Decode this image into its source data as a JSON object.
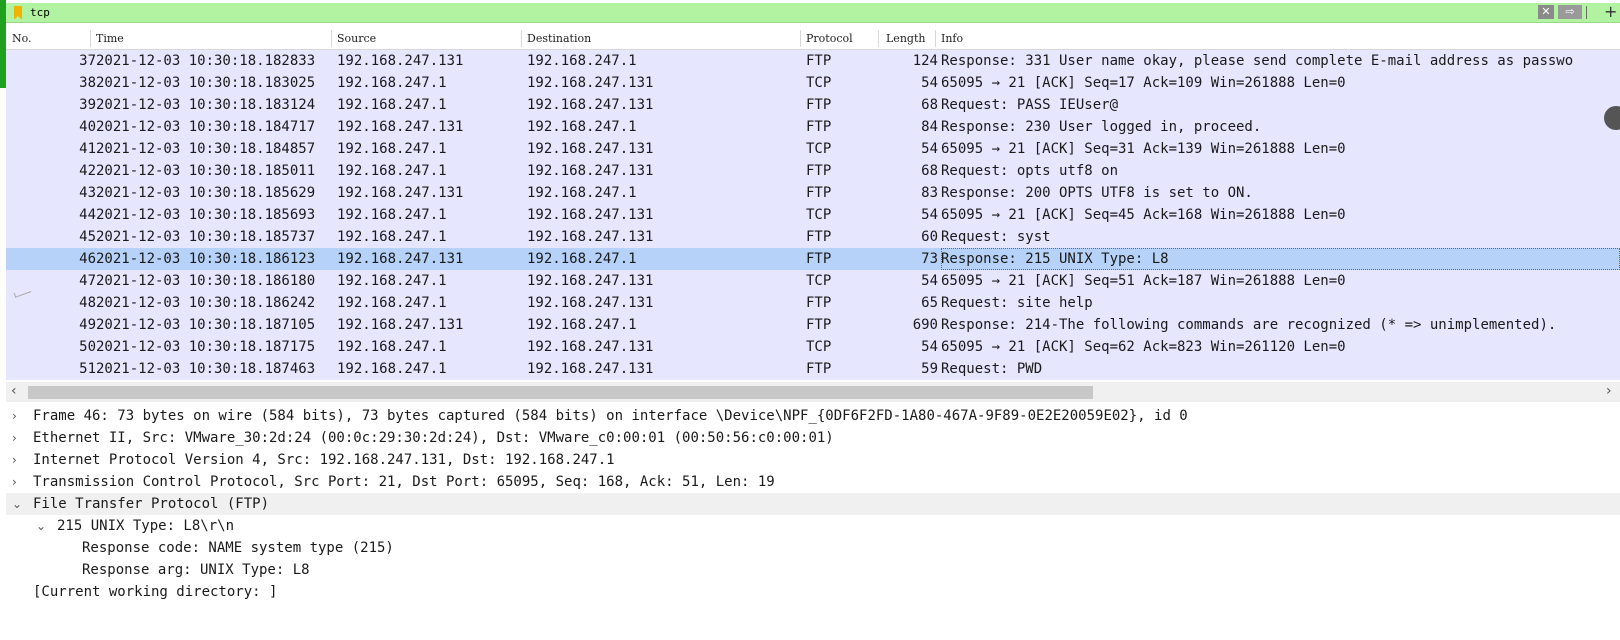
{
  "filter": {
    "value": "tcp"
  },
  "columns": [
    "No.",
    "Time",
    "Source",
    "Destination",
    "Protocol",
    "Length",
    "Info"
  ],
  "packets": [
    {
      "no": "37",
      "time": "2021-12-03 10:30:18.182833",
      "src": "192.168.247.131",
      "dst": "192.168.247.1",
      "proto": "FTP",
      "len": "124",
      "info": "Response: 331 User name okay, please send complete E-mail address as passwo"
    },
    {
      "no": "38",
      "time": "2021-12-03 10:30:18.183025",
      "src": "192.168.247.1",
      "dst": "192.168.247.131",
      "proto": "TCP",
      "len": "54",
      "info": "65095 → 21 [ACK] Seq=17 Ack=109 Win=261888 Len=0"
    },
    {
      "no": "39",
      "time": "2021-12-03 10:30:18.183124",
      "src": "192.168.247.1",
      "dst": "192.168.247.131",
      "proto": "FTP",
      "len": "68",
      "info": "Request: PASS IEUser@"
    },
    {
      "no": "40",
      "time": "2021-12-03 10:30:18.184717",
      "src": "192.168.247.131",
      "dst": "192.168.247.1",
      "proto": "FTP",
      "len": "84",
      "info": "Response: 230 User logged in, proceed."
    },
    {
      "no": "41",
      "time": "2021-12-03 10:30:18.184857",
      "src": "192.168.247.1",
      "dst": "192.168.247.131",
      "proto": "TCP",
      "len": "54",
      "info": "65095 → 21 [ACK] Seq=31 Ack=139 Win=261888 Len=0"
    },
    {
      "no": "42",
      "time": "2021-12-03 10:30:18.185011",
      "src": "192.168.247.1",
      "dst": "192.168.247.131",
      "proto": "FTP",
      "len": "68",
      "info": "Request: opts utf8 on"
    },
    {
      "no": "43",
      "time": "2021-12-03 10:30:18.185629",
      "src": "192.168.247.131",
      "dst": "192.168.247.1",
      "proto": "FTP",
      "len": "83",
      "info": "Response: 200 OPTS UTF8 is set to ON."
    },
    {
      "no": "44",
      "time": "2021-12-03 10:30:18.185693",
      "src": "192.168.247.1",
      "dst": "192.168.247.131",
      "proto": "TCP",
      "len": "54",
      "info": "65095 → 21 [ACK] Seq=45 Ack=168 Win=261888 Len=0"
    },
    {
      "no": "45",
      "time": "2021-12-03 10:30:18.185737",
      "src": "192.168.247.1",
      "dst": "192.168.247.131",
      "proto": "FTP",
      "len": "60",
      "info": "Request: syst"
    },
    {
      "no": "46",
      "time": "2021-12-03 10:30:18.186123",
      "src": "192.168.247.131",
      "dst": "192.168.247.1",
      "proto": "FTP",
      "len": "73",
      "info": "Response: 215 UNIX Type: L8",
      "selected": true
    },
    {
      "no": "47",
      "time": "2021-12-03 10:30:18.186180",
      "src": "192.168.247.1",
      "dst": "192.168.247.131",
      "proto": "TCP",
      "len": "54",
      "info": "65095 → 21 [ACK] Seq=51 Ack=187 Win=261888 Len=0"
    },
    {
      "no": "48",
      "time": "2021-12-03 10:30:18.186242",
      "src": "192.168.247.1",
      "dst": "192.168.247.131",
      "proto": "FTP",
      "len": "65",
      "info": "Request: site help"
    },
    {
      "no": "49",
      "time": "2021-12-03 10:30:18.187105",
      "src": "192.168.247.131",
      "dst": "192.168.247.1",
      "proto": "FTP",
      "len": "690",
      "info": "Response: 214-The following commands are recognized (* => unimplemented)."
    },
    {
      "no": "50",
      "time": "2021-12-03 10:30:18.187175",
      "src": "192.168.247.1",
      "dst": "192.168.247.131",
      "proto": "TCP",
      "len": "54",
      "info": "65095 → 21 [ACK] Seq=62 Ack=823 Win=261120 Len=0"
    },
    {
      "no": "51",
      "time": "2021-12-03 10:30:18.187463",
      "src": "192.168.247.1",
      "dst": "192.168.247.131",
      "proto": "FTP",
      "len": "59",
      "info": "Request: PWD"
    }
  ],
  "details": [
    {
      "twisty": "›",
      "text": "Frame 46: 73 bytes on wire (584 bits), 73 bytes captured (584 bits) on interface \\Device\\NPF_{0DF6F2FD-1A80-467A-9F89-0E2E20059E02}, id 0",
      "level": 0
    },
    {
      "twisty": "›",
      "text": "Ethernet II, Src: VMware_30:2d:24 (00:0c:29:30:2d:24), Dst: VMware_c0:00:01 (00:50:56:c0:00:01)",
      "level": 0
    },
    {
      "twisty": "›",
      "text": "Internet Protocol Version 4, Src: 192.168.247.131, Dst: 192.168.247.1",
      "level": 0
    },
    {
      "twisty": "›",
      "text": "Transmission Control Protocol, Src Port: 21, Dst Port: 65095, Seq: 168, Ack: 51, Len: 19",
      "level": 0
    },
    {
      "twisty": "⌄",
      "text": "File Transfer Protocol (FTP)",
      "level": 0,
      "stripe": true
    },
    {
      "twisty": "⌄",
      "text": "215 UNIX Type: L8\\r\\n",
      "level": 1
    },
    {
      "twisty": "",
      "text": "Response code: NAME system type (215)",
      "level": 2
    },
    {
      "twisty": "",
      "text": "Response arg: UNIX Type: L8",
      "level": 2
    },
    {
      "twisty": "",
      "text": "[Current working directory: ]",
      "level": 0
    }
  ]
}
